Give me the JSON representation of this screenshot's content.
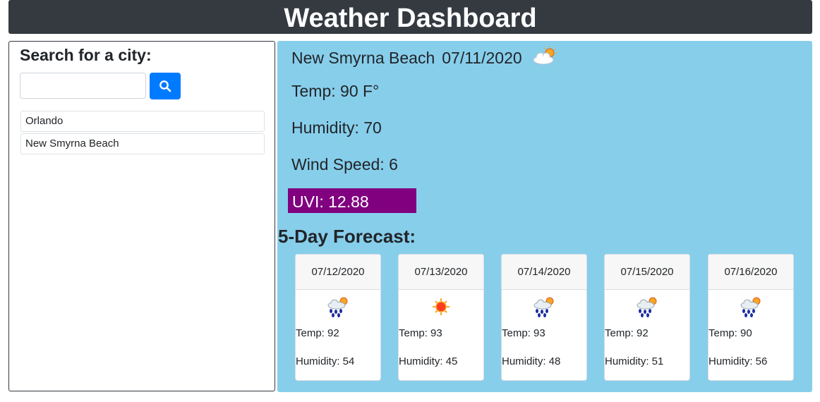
{
  "header": {
    "title": "Weather Dashboard"
  },
  "sidebar": {
    "heading": "Search for a city:",
    "search": {
      "value": "",
      "placeholder": ""
    },
    "search_button_icon": "search-icon",
    "cities": [
      "Orlando",
      "New Smyrna Beach"
    ]
  },
  "current": {
    "city": "New Smyrna Beach",
    "date": "07/11/2020",
    "icon": "partly-cloudy-icon",
    "temp": "Temp: 90 F°",
    "humidity": "Humidity: 70",
    "wind": "Wind Speed: 6",
    "uvi": "UVI: 12.88",
    "uvi_color": "#800080"
  },
  "forecast": {
    "title": "5-Day Forecast:",
    "days": [
      {
        "date": "07/12/2020",
        "icon": "rain-sun-icon",
        "temp": "Temp: 92",
        "humidity": "Humidity: 54"
      },
      {
        "date": "07/13/2020",
        "icon": "sun-icon",
        "temp": "Temp: 93",
        "humidity": "Humidity: 45"
      },
      {
        "date": "07/14/2020",
        "icon": "rain-sun-icon",
        "temp": "Temp: 93",
        "humidity": "Humidity: 48"
      },
      {
        "date": "07/15/2020",
        "icon": "rain-sun-icon",
        "temp": "Temp: 92",
        "humidity": "Humidity: 51"
      },
      {
        "date": "07/16/2020",
        "icon": "rain-sun-icon",
        "temp": "Temp: 90",
        "humidity": "Humidity: 56"
      }
    ]
  },
  "colors": {
    "header_bg": "#343a40",
    "main_bg": "#87ceeb",
    "button_bg": "#007bff"
  }
}
